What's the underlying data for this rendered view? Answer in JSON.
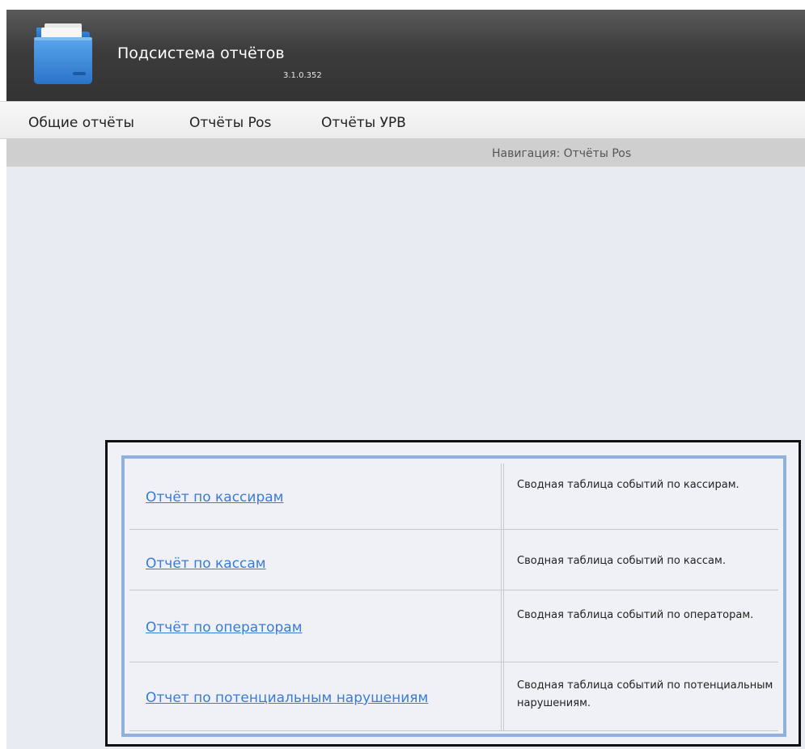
{
  "header": {
    "title": "Подсистема отчётов",
    "version": "3.1.0.352",
    "logo_icon": "folder-icon",
    "colors": {
      "bar": "#3c3c3c",
      "folder_blue": "#2f7fd6"
    }
  },
  "menu": {
    "items": [
      {
        "label": "Общие отчёты"
      },
      {
        "label": "Отчёты Pos"
      },
      {
        "label": "Отчёты УРВ"
      }
    ]
  },
  "navigation": {
    "text": "Навигация: Отчёты Pos"
  },
  "reports": [
    {
      "name": "Отчёт по кассирам",
      "description": "Сводная таблица событий по кассирам."
    },
    {
      "name": "Отчёт по кассам",
      "description": "Сводная таблица событий по кассам."
    },
    {
      "name": "Отчёт по операторам",
      "description": "Сводная таблица событий по операторам."
    },
    {
      "name": "Отчет по потенциальным нарушениям",
      "description": "Сводная таблица событий по потенциальным нарушениям."
    }
  ],
  "colors": {
    "link": "#3a7bd5",
    "table_border": "#8eb1de",
    "content_bg": "#e8ebf1"
  }
}
